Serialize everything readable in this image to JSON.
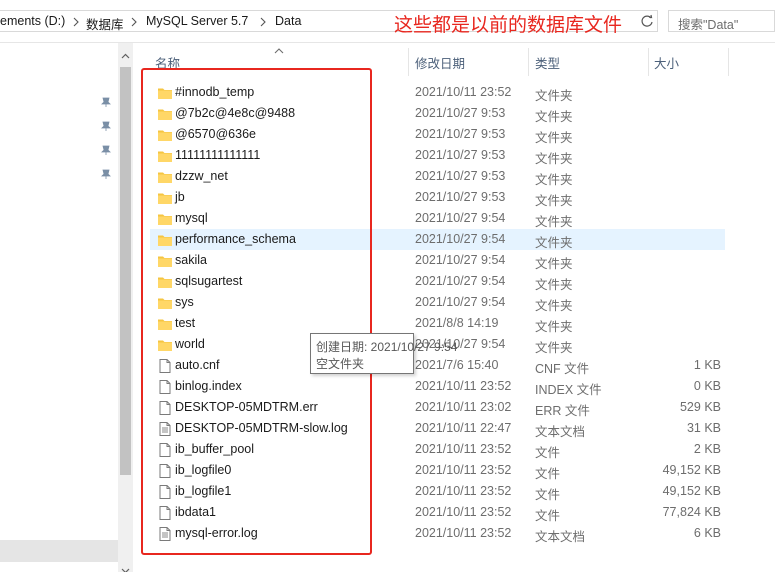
{
  "address_bar": {
    "breadcrumbs": [
      "ements (D:)",
      "数据库",
      "MySQL Server 5.7",
      "Data"
    ],
    "search_placeholder": "搜索\"Data\""
  },
  "annotation_text": "这些都是以前的数据库文件",
  "columns": {
    "name": "名称",
    "date": "修改日期",
    "type": "类型",
    "size": "大小"
  },
  "files": [
    {
      "name": "#innodb_temp",
      "date": "2021/10/11 23:52",
      "type": "文件夹",
      "size": "",
      "icon": "folder-icon"
    },
    {
      "name": "@7b2c@4e8c@9488",
      "date": "2021/10/27 9:53",
      "type": "文件夹",
      "size": "",
      "icon": "folder-icon"
    },
    {
      "name": "@6570@636e",
      "date": "2021/10/27 9:53",
      "type": "文件夹",
      "size": "",
      "icon": "folder-icon"
    },
    {
      "name": "11111111111111",
      "date": "2021/10/27 9:53",
      "type": "文件夹",
      "size": "",
      "icon": "folder-icon"
    },
    {
      "name": "dzzw_net",
      "date": "2021/10/27 9:53",
      "type": "文件夹",
      "size": "",
      "icon": "folder-icon"
    },
    {
      "name": "jb",
      "date": "2021/10/27 9:53",
      "type": "文件夹",
      "size": "",
      "icon": "folder-icon"
    },
    {
      "name": "mysql",
      "date": "2021/10/27 9:54",
      "type": "文件夹",
      "size": "",
      "icon": "folder-icon"
    },
    {
      "name": "performance_schema",
      "date": "2021/10/27 9:54",
      "type": "文件夹",
      "size": "",
      "icon": "folder-icon"
    },
    {
      "name": "sakila",
      "date": "2021/10/27 9:54",
      "type": "文件夹",
      "size": "",
      "icon": "folder-icon"
    },
    {
      "name": "sqlsugartest",
      "date": "2021/10/27 9:54",
      "type": "文件夹",
      "size": "",
      "icon": "folder-icon"
    },
    {
      "name": "sys",
      "date": "2021/10/27 9:54",
      "type": "文件夹",
      "size": "",
      "icon": "folder-icon"
    },
    {
      "name": "test",
      "date": "2021/8/8 14:19",
      "type": "文件夹",
      "size": "",
      "icon": "folder-icon"
    },
    {
      "name": "world",
      "date": "2021/10/27 9:54",
      "type": "文件夹",
      "size": "",
      "icon": "folder-icon"
    },
    {
      "name": "auto.cnf",
      "date": "2021/7/6 15:40",
      "type": "CNF 文件",
      "size": "1 KB",
      "icon": "file-icon"
    },
    {
      "name": "binlog.index",
      "date": "2021/10/11 23:52",
      "type": "INDEX 文件",
      "size": "0 KB",
      "icon": "file-icon"
    },
    {
      "name": "DESKTOP-05MDTRM.err",
      "date": "2021/10/11 23:02",
      "type": "ERR 文件",
      "size": "529 KB",
      "icon": "file-icon"
    },
    {
      "name": "DESKTOP-05MDTRM-slow.log",
      "date": "2021/10/11 22:47",
      "type": "文本文档",
      "size": "31 KB",
      "icon": "text-file-icon"
    },
    {
      "name": "ib_buffer_pool",
      "date": "2021/10/11 23:52",
      "type": "文件",
      "size": "2 KB",
      "icon": "file-icon"
    },
    {
      "name": "ib_logfile0",
      "date": "2021/10/11 23:52",
      "type": "文件",
      "size": "49,152 KB",
      "icon": "file-icon"
    },
    {
      "name": "ib_logfile1",
      "date": "2021/10/11 23:52",
      "type": "文件",
      "size": "49,152 KB",
      "icon": "file-icon"
    },
    {
      "name": "ibdata1",
      "date": "2021/10/11 23:52",
      "type": "文件",
      "size": "77,824 KB",
      "icon": "file-icon"
    },
    {
      "name": "mysql-error.log",
      "date": "2021/10/11 23:52",
      "type": "文本文档",
      "size": "6 KB",
      "icon": "text-file-icon"
    }
  ],
  "hovered_row": "performance_schema",
  "tooltip": {
    "line1": "创建日期: 2021/10/27 9:54",
    "line2": "空文件夹"
  },
  "colors": {
    "annotation_red": "#e8271f",
    "hover_row": "#e5f3ff",
    "folder_yellow": "#ffd767"
  }
}
